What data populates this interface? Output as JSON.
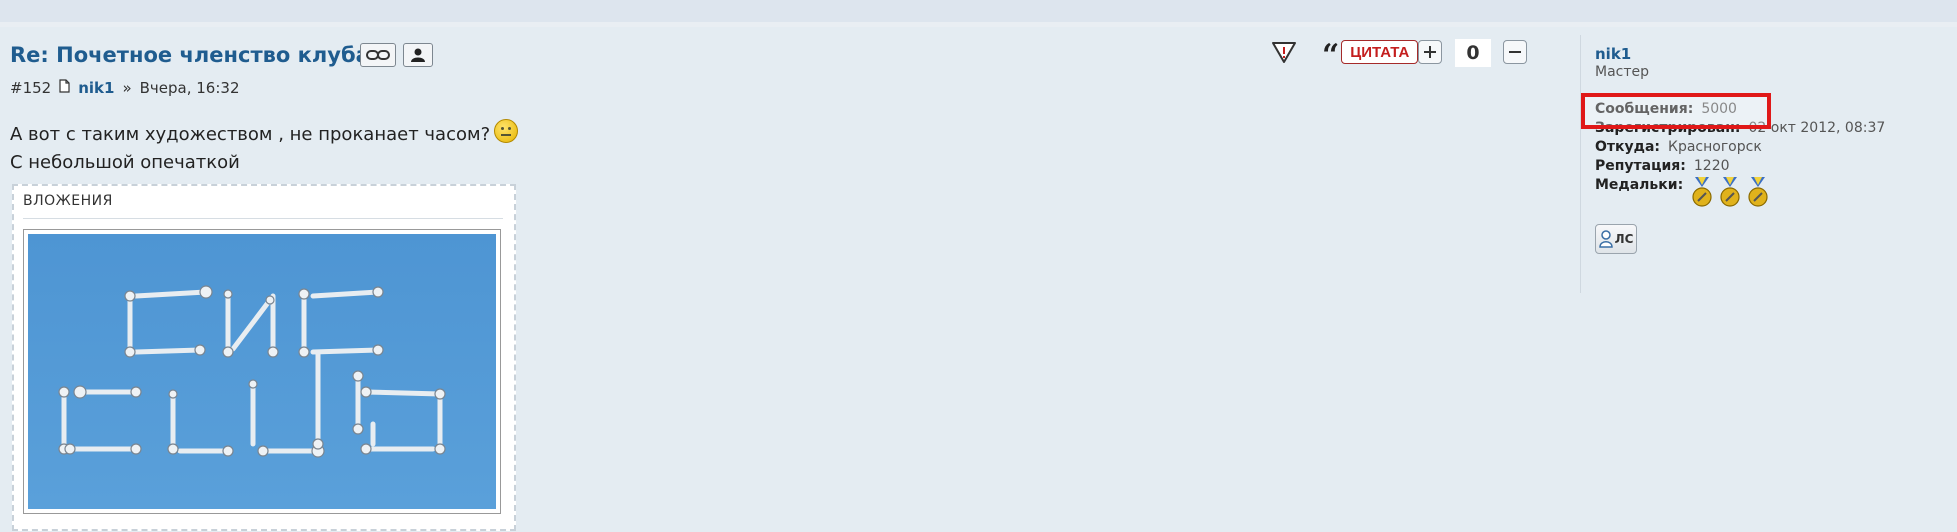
{
  "post": {
    "title": "Re: Почетное членство клуба",
    "number": "#152",
    "author": "nik1",
    "separator": "»",
    "date": "Вчера, 16:32",
    "body_line1": "А вот с таким художеством , не проканает часом?",
    "body_line2": "С небольшой опечаткой"
  },
  "attachments": {
    "heading": "ВЛОЖЕНИЯ"
  },
  "toolbar": {
    "quote_label": "ЦИТАТА",
    "vote_count": "0"
  },
  "profile": {
    "name": "nik1",
    "rank": "Мастер",
    "messages_label": "Сообщения:",
    "messages_value": "5000",
    "registered_label": "Зарегистрирован:",
    "registered_value": "02 окт 2012, 08:37",
    "from_label": "Откуда:",
    "from_value": "Красногорск",
    "reputation_label": "Репутация:",
    "reputation_value": "1220",
    "medals_label": "Медальки:",
    "medals_count": 3,
    "pm_label": "ЛС"
  },
  "colors": {
    "link": "#1f5c8f",
    "highlight": "#e01818",
    "quote_red": "#c41e1e"
  }
}
